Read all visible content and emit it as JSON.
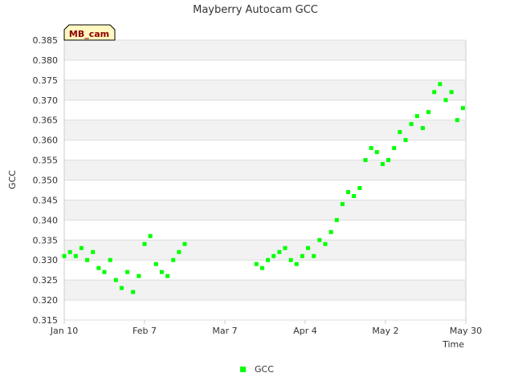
{
  "chart_data": {
    "type": "scatter",
    "title": "Mayberry Autocam GCC",
    "xlabel": "Time",
    "ylabel": "GCC",
    "ylim": [
      0.315,
      0.385
    ],
    "yticks": [
      "0.315",
      "0.320",
      "0.325",
      "0.330",
      "0.335",
      "0.340",
      "0.345",
      "0.350",
      "0.355",
      "0.360",
      "0.365",
      "0.370",
      "0.375",
      "0.380",
      "0.385"
    ],
    "xlim": [
      "2023-01-10",
      "2023-05-30"
    ],
    "xticks": [
      {
        "date": "2023-01-10",
        "label": "Jan 10"
      },
      {
        "date": "2023-02-07",
        "label": "Feb 7"
      },
      {
        "date": "2023-03-07",
        "label": "Mar 7"
      },
      {
        "date": "2023-04-04",
        "label": "Apr 4"
      },
      {
        "date": "2023-05-02",
        "label": "May 2"
      },
      {
        "date": "2023-05-30",
        "label": "May 30"
      }
    ],
    "grid": true,
    "legend_position": "bottom-center",
    "series": [
      {
        "name": "GCC",
        "color": "#00ff00",
        "x": [
          "2023-01-10",
          "2023-01-12",
          "2023-01-14",
          "2023-01-16",
          "2023-01-18",
          "2023-01-20",
          "2023-01-22",
          "2023-01-24",
          "2023-01-26",
          "2023-01-28",
          "2023-01-30",
          "2023-02-01",
          "2023-02-03",
          "2023-02-05",
          "2023-02-07",
          "2023-02-09",
          "2023-02-11",
          "2023-02-13",
          "2023-02-15",
          "2023-02-17",
          "2023-02-19",
          "2023-02-21",
          "2023-03-18",
          "2023-03-20",
          "2023-03-22",
          "2023-03-24",
          "2023-03-26",
          "2023-03-28",
          "2023-03-30",
          "2023-04-01",
          "2023-04-03",
          "2023-04-05",
          "2023-04-07",
          "2023-04-09",
          "2023-04-11",
          "2023-04-13",
          "2023-04-15",
          "2023-04-17",
          "2023-04-19",
          "2023-04-21",
          "2023-04-23",
          "2023-04-25",
          "2023-04-27",
          "2023-04-29",
          "2023-05-01",
          "2023-05-03",
          "2023-05-05",
          "2023-05-07",
          "2023-05-09",
          "2023-05-11",
          "2023-05-13",
          "2023-05-15",
          "2023-05-17",
          "2023-05-19",
          "2023-05-21",
          "2023-05-23",
          "2023-05-25",
          "2023-05-27",
          "2023-05-29"
        ],
        "values": [
          0.331,
          0.332,
          0.331,
          0.333,
          0.33,
          0.332,
          0.328,
          0.327,
          0.33,
          0.325,
          0.323,
          0.327,
          0.322,
          0.326,
          0.334,
          0.336,
          0.329,
          0.327,
          0.326,
          0.33,
          0.332,
          0.334,
          0.329,
          0.328,
          0.33,
          0.331,
          0.332,
          0.333,
          0.33,
          0.329,
          0.331,
          0.333,
          0.331,
          0.335,
          0.334,
          0.337,
          0.34,
          0.344,
          0.347,
          0.346,
          0.348,
          0.355,
          0.358,
          0.357,
          0.354,
          0.355,
          0.358,
          0.362,
          0.36,
          0.364,
          0.366,
          0.363,
          0.367,
          0.372,
          0.374,
          0.37,
          0.372,
          0.365,
          0.368
        ]
      }
    ]
  },
  "tag": {
    "label": "MB_cam",
    "fill": "#fff8c0",
    "border": "#000000",
    "text_color": "#8b0000"
  },
  "legend": {
    "items": [
      {
        "label": "GCC",
        "color": "#00ff00"
      }
    ]
  },
  "colors": {
    "band_gray": "#f2f2f2",
    "grid_line": "#dddddd",
    "axis": "#cccccc"
  }
}
